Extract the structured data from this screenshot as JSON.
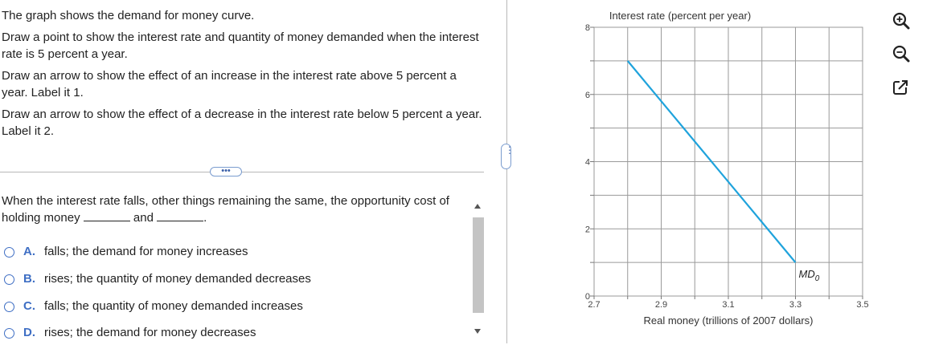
{
  "question": {
    "intro": "The graph shows the demand for money curve.",
    "task1": "Draw a point to show the interest rate and quantity of money demanded when the interest rate is 5 percent a year.",
    "task2": "Draw an arrow to show the effect of an increase in the interest rate above 5 percent a year. Label it 1.",
    "task3": "Draw an arrow to show the effect of a decrease in the interest rate below 5 percent a year. Label it 2."
  },
  "more_button": "•••",
  "sub_question": {
    "part1": "When the interest rate falls, other things remaining the same, the opportunity cost of holding money",
    "and": "and",
    "end": "."
  },
  "options": [
    {
      "letter": "A.",
      "text": "falls; the demand for money increases"
    },
    {
      "letter": "B.",
      "text": "rises; the quantity of money demanded decreases"
    },
    {
      "letter": "C.",
      "text": "falls; the quantity of money demanded increases"
    },
    {
      "letter": "D.",
      "text": "rises; the demand for money decreases"
    }
  ],
  "chart_data": {
    "type": "line",
    "ylabel": "Interest rate (percent per year)",
    "xlabel": "Real money (trillions of 2007 dollars)",
    "xlim": [
      2.7,
      3.5
    ],
    "ylim": [
      0,
      8
    ],
    "x_ticks": [
      "2.7",
      "2.9",
      "3.1",
      "3.3",
      "3.5"
    ],
    "y_ticks": [
      "0",
      "2",
      "4",
      "6",
      "8"
    ],
    "grid": true,
    "series": [
      {
        "name": "MD",
        "subscript": "0",
        "color": "#1fa3dc",
        "x": [
          2.8,
          3.3
        ],
        "y": [
          7,
          1
        ]
      }
    ]
  },
  "tools": [
    {
      "name": "zoom-in"
    },
    {
      "name": "zoom-out"
    },
    {
      "name": "open-external"
    }
  ]
}
